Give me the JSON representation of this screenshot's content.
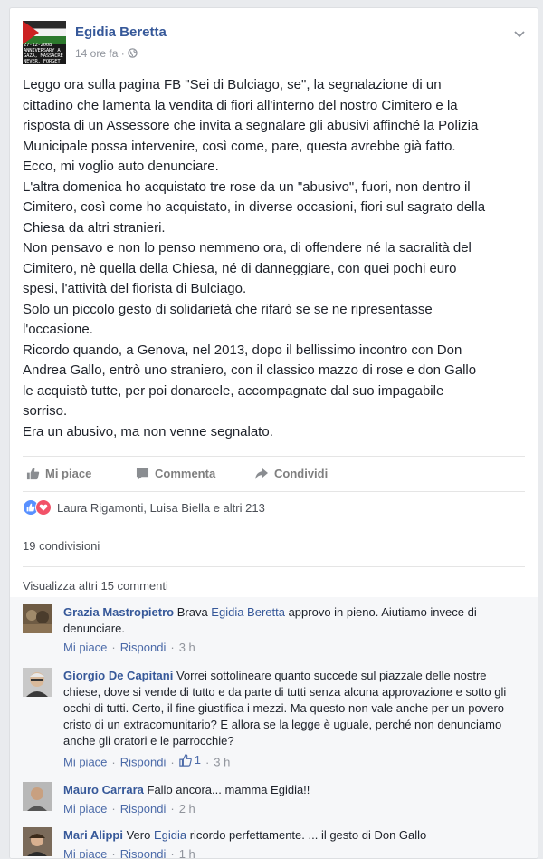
{
  "post": {
    "author": "Egidia Beretta",
    "time": "14 ore fa",
    "avatar_text": "27-12-2008 ANNIVERSARY A GAZA, MASSACRE NEVER, FORGET",
    "body": "Leggo ora sulla pagina FB \"Sei di Bulciago, se\", la segnalazione di un\ncittadino che lamenta la vendita di fiori all'interno del nostro Cimitero e la\nrisposta di un Assessore che invita a segnalare gli abusivi affinché la Polizia\nMunicipale possa intervenire, così come, pare, questa avrebbe già fatto.\nEcco, mi voglio auto denunciare.\nL'altra domenica ho acquistato tre rose da un \"abusivo\", fuori, non dentro il\nCimitero, così come ho acquistato, in diverse occasioni, fiori sul sagrato della\nChiesa da altri stranieri.\nNon pensavo e non lo penso nemmeno ora, di offendere né la sacralità del\nCimitero, nè quella della Chiesa, né di danneggiare, con quei pochi euro\nspesi, l'attività del fiorista di Bulciago.\nSolo un piccolo gesto di solidarietà che rifarò se se ne ripresentasse\nl'occasione.\nRicordo quando, a Genova, nel 2013, dopo il bellissimo incontro con Don\nAndrea Gallo, entrò uno straniero, con il classico mazzo di rose e don Gallo\nle acquistò tutte, per poi donarcele, accompagnate dal suo impagabile\nsorriso.\nEra un abusivo, ma non venne segnalato."
  },
  "actions": {
    "like": "Mi piace",
    "comment": "Commenta",
    "share": "Condividi"
  },
  "reactions": {
    "text": "Laura Rigamonti, Luisa Biella e altri 213"
  },
  "shares": "19 condivisioni",
  "more_comments": "Visualizza altri 15 commenti",
  "comments": [
    {
      "author": "Grazia Mastropietro",
      "pre": "Brava ",
      "tag": "Egidia Beretta",
      "text": " approvo in pieno. Aiutiamo invece di denunciare.",
      "like": "Mi piace",
      "reply": "Rispondi",
      "time": "3 h"
    },
    {
      "author": "Giorgio De Capitani",
      "text": "Vorrei sottolineare quanto succede sul piazzale delle nostre chiese, dove si vende di tutto e da parte di tutti senza alcuna approvazione e sotto gli occhi di tutti. Certo, il fine giustifica i mezzi. Ma questo non vale anche per un povero cristo di un extracomunitario? E allora se la legge è uguale, perché non denunciamo anche gli oratori e le parrocchie?",
      "like": "Mi piace",
      "reply": "Rispondi",
      "likes_count": "1",
      "time": "3 h"
    },
    {
      "author": "Mauro Carrara",
      "text": "Fallo ancora... mamma Egidia!!",
      "like": "Mi piace",
      "reply": "Rispondi",
      "time": "2 h"
    },
    {
      "author": "Mari Alippi",
      "pre": "Vero ",
      "tag": "Egidia",
      "text": " ricordo perfettamente. ... il gesto di Don Gallo",
      "like": "Mi piace",
      "reply": "Rispondi",
      "time": "1 h"
    }
  ],
  "colors": {
    "link": "#365899",
    "meta": "#90949c",
    "like_reaction": "#5890ff",
    "love_reaction": "#f25268"
  }
}
